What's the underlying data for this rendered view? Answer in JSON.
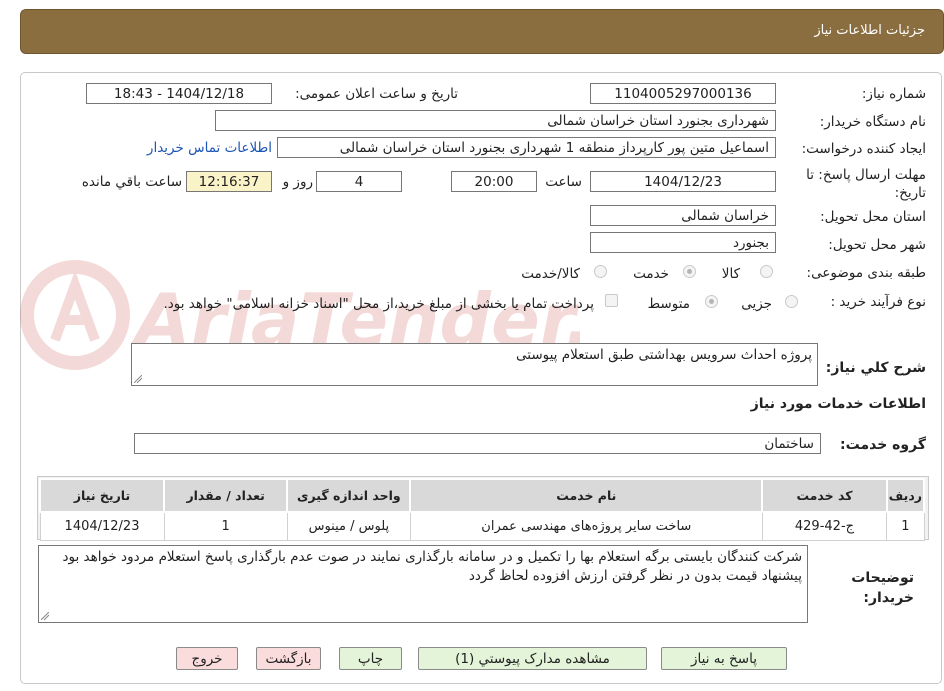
{
  "header": {
    "title": "جزئیات اطلاعات نیاز"
  },
  "watermark": {
    "text": "AriaTender.neT"
  },
  "form": {
    "need_number": {
      "label": "شماره نیاز:",
      "value": "1104005297000136"
    },
    "announce_datetime": {
      "label": "تاریخ و ساعت اعلان عمومی:",
      "value": "1404/12/18 - 18:43"
    },
    "buyer_org": {
      "label": "نام دستگاه خریدار:",
      "value": "شهرداری بجنورد استان خراسان شمالی"
    },
    "requester": {
      "label": "ایجاد کننده درخواست:",
      "value": "اسماعیل متین پور کارپرداز منطقه 1 شهرداری بجنورد استان خراسان شمالی"
    },
    "contact_link": "اطلاعات تماس خریدار",
    "deadline": {
      "label": "مهلت ارسال پاسخ: تا تاریخ:",
      "date": "1404/12/23",
      "time_label": "ساعت",
      "time": "20:00",
      "days": "4",
      "days_label": "روز و",
      "remaining": "12:16:37",
      "remaining_label": "ساعت باقي مانده"
    },
    "delivery_province": {
      "label": "استان محل تحویل:",
      "value": "خراسان شمالی"
    },
    "delivery_city": {
      "label": "شهر محل تحویل:",
      "value": "بجنورد"
    },
    "category": {
      "label": "طبقه بندی موضوعی:",
      "options": [
        "کالا",
        "خدمت",
        "کالا/خدمت"
      ],
      "selected": "خدمت"
    },
    "purchase_type": {
      "label": "نوع فرآیند خرید :",
      "options": [
        "جزیی",
        "متوسط"
      ],
      "selected": "متوسط",
      "note": "پرداخت تمام یا بخشی از مبلغ خرید،از محل \"اسناد خزانه اسلامی\" خواهد بود."
    },
    "description": {
      "label": "شرح کلي نیاز:",
      "value": "پروژه احداث سرویس بهداشتی طبق استعلام پیوستی"
    },
    "services_title": "اطلاعات خدمات مورد نیاز",
    "service_group": {
      "label": "گروه خدمت:",
      "value": "ساختمان"
    }
  },
  "table": {
    "headers": [
      "ردیف",
      "کد خدمت",
      "نام خدمت",
      "واحد اندازه گیری",
      "تعداد / مقدار",
      "تاریخ نیاز"
    ],
    "rows": [
      [
        "1",
        "ج-42-429",
        "ساخت سایر پروژه‌های مهندسی عمران",
        "پلوس / مینوس",
        "1",
        "1404/12/23"
      ]
    ]
  },
  "buyer_notes": {
    "label": "توضیحات خریدار:",
    "value": "شرکت کنندگان بایستی برگه استعلام بها را تکمیل و در سامانه بارگذاری نمایند در صوت عدم بارگذاری پاسخ استعلام مردود خواهد بود پیشنهاد قیمت بدون در نظر گرفتن ارزش افزوده لحاظ گردد"
  },
  "buttons": {
    "reply": "پاسخ به نیاز",
    "attachments": "مشاهده مدارک پیوستي (1)",
    "print": "چاپ",
    "back": "بازگشت",
    "exit": "خروج"
  },
  "colors": {
    "header_bg": "#8b6e3f",
    "link": "#1b55b5",
    "remaining_bg": "#fbf3c8"
  }
}
